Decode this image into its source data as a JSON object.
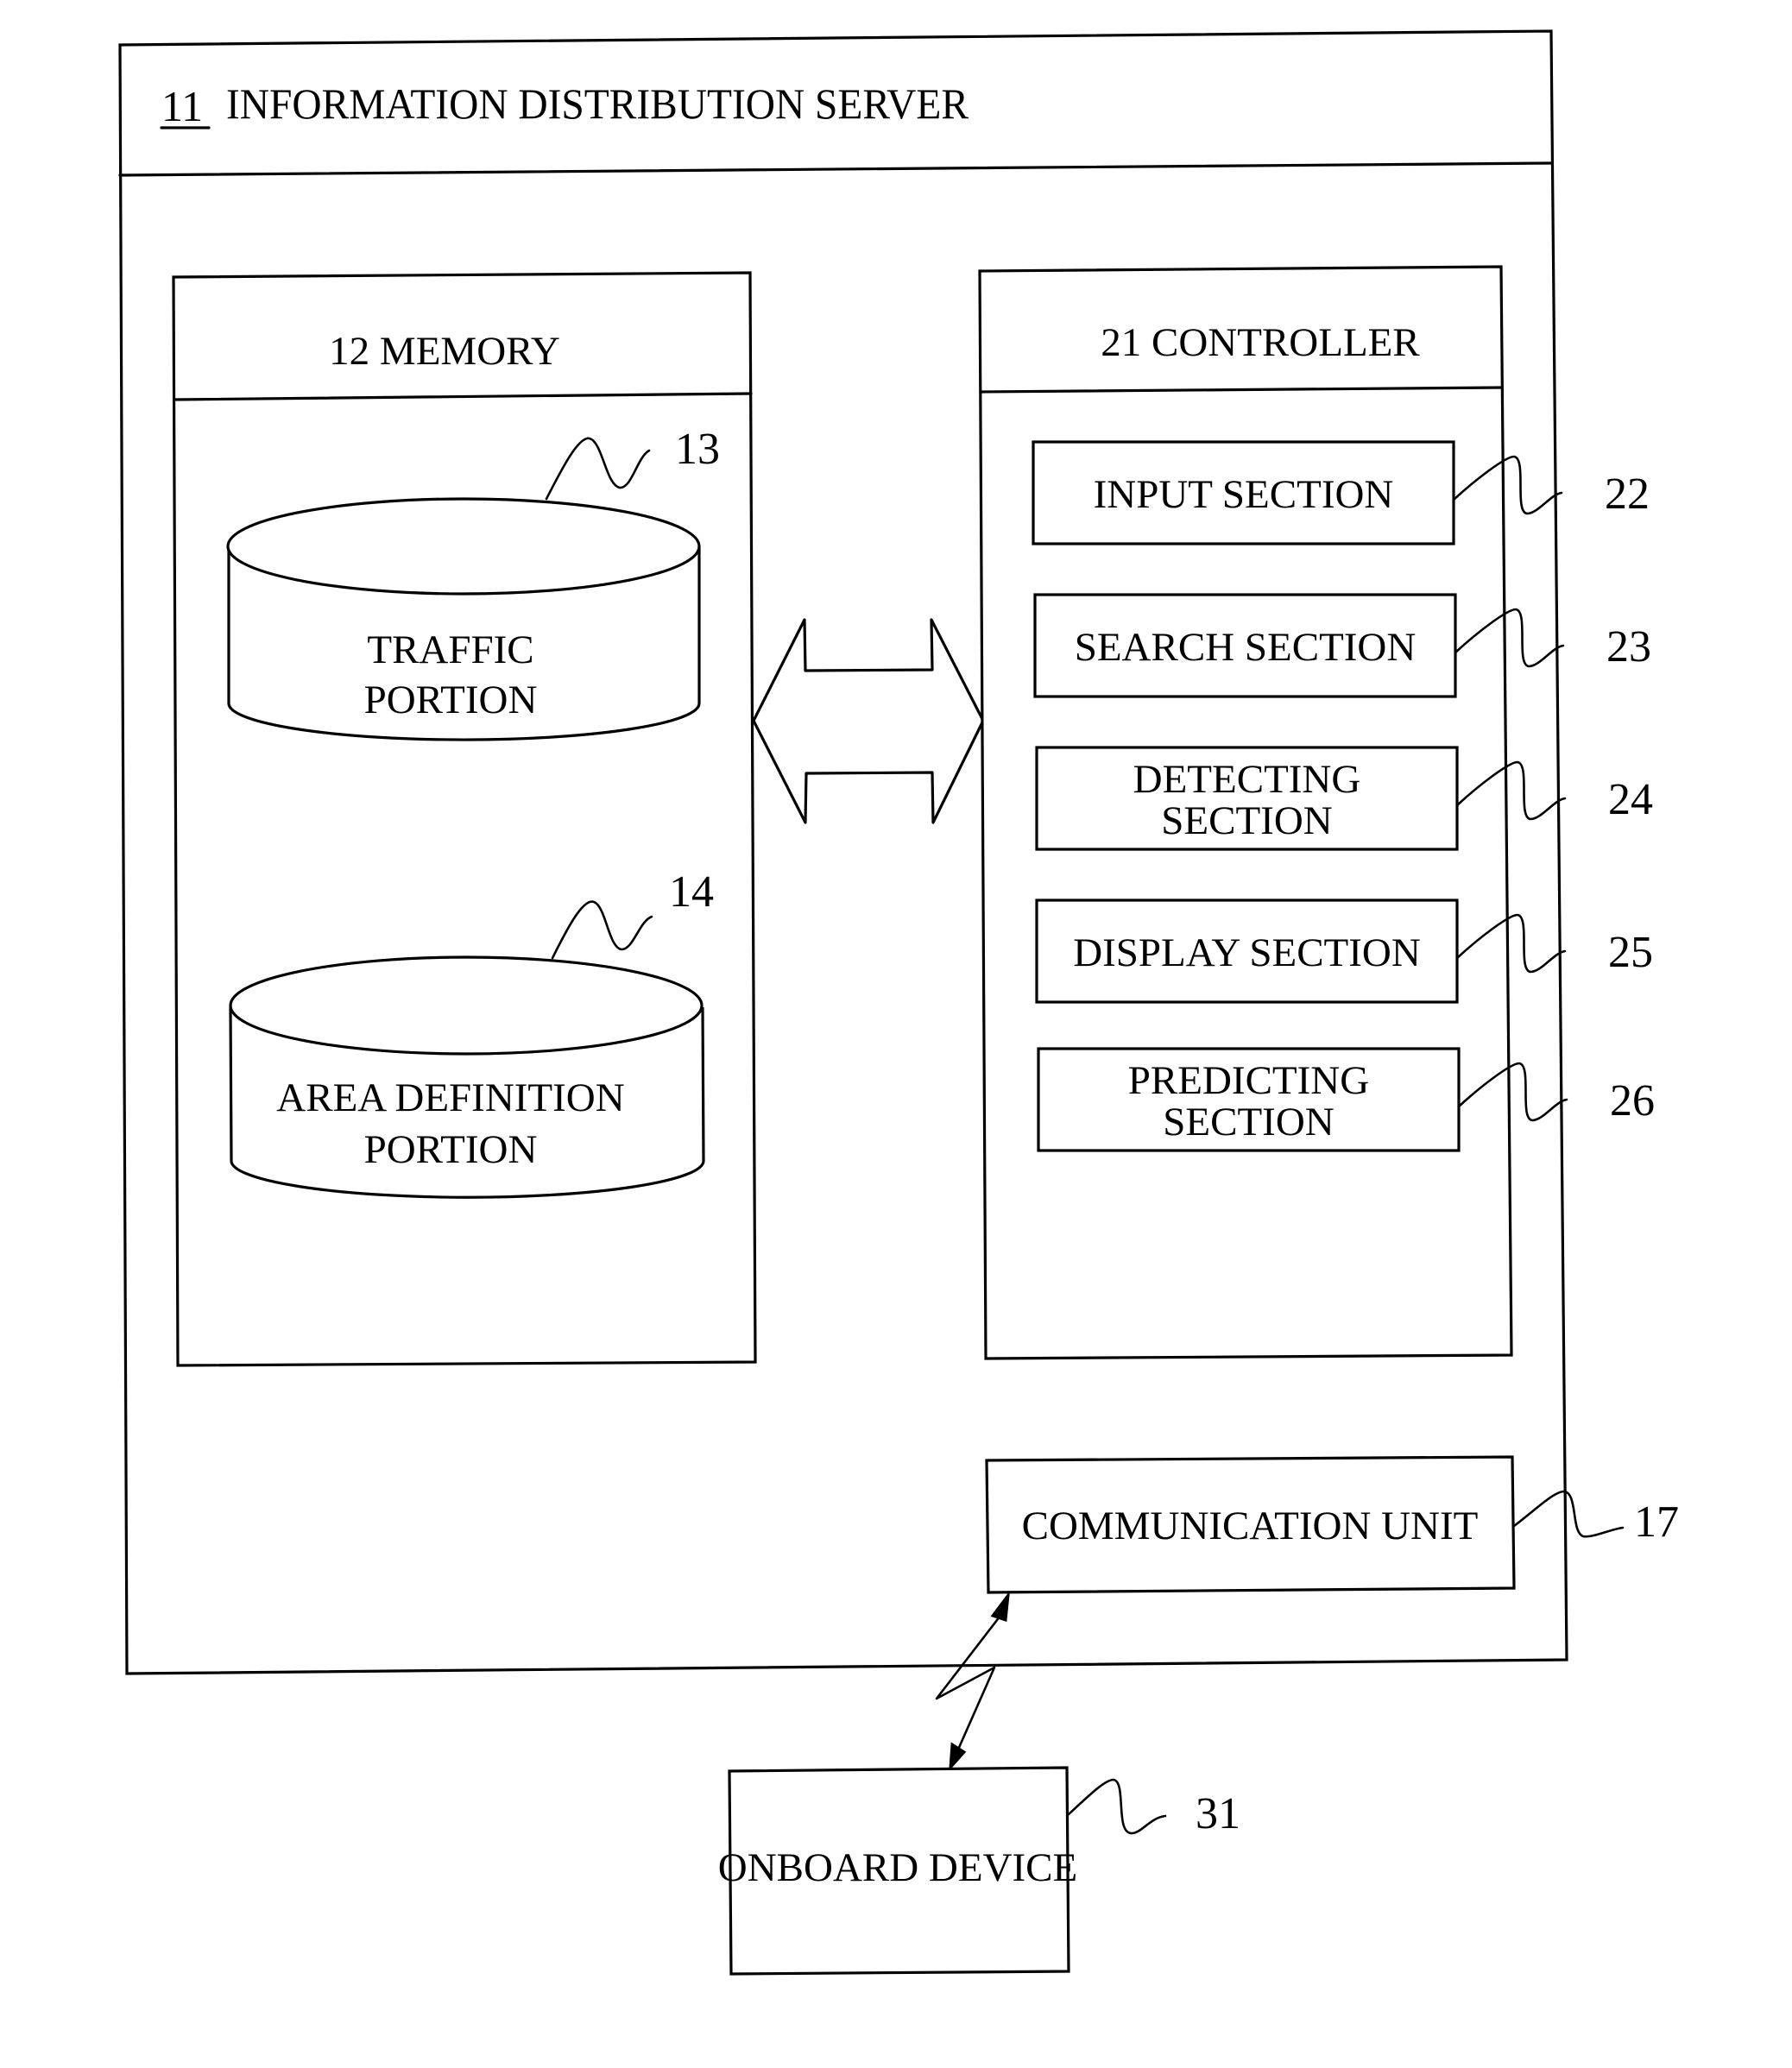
{
  "diagram": {
    "server": {
      "ref": "11",
      "label": "INFORMATION DISTRIBUTION SERVER"
    },
    "memory": {
      "header": "12 MEMORY",
      "traffic": {
        "ref": "13",
        "line1": "TRAFFIC",
        "line2": "PORTION"
      },
      "area": {
        "ref": "14",
        "line1": "AREA DEFINITION",
        "line2": "PORTION"
      }
    },
    "controller": {
      "header": "21 CONTROLLER",
      "sections": [
        {
          "ref": "22",
          "line1": "INPUT SECTION",
          "line2": ""
        },
        {
          "ref": "23",
          "line1": "SEARCH SECTION",
          "line2": ""
        },
        {
          "ref": "24",
          "line1": "DETECTING",
          "line2": "SECTION"
        },
        {
          "ref": "25",
          "line1": "DISPLAY SECTION",
          "line2": ""
        },
        {
          "ref": "26",
          "line1": "PREDICTING",
          "line2": "SECTION"
        }
      ]
    },
    "communication_unit": {
      "ref": "17",
      "label": "COMMUNICATION UNIT"
    },
    "onboard_device": {
      "ref": "31",
      "label": "ONBOARD DEVICE"
    },
    "connections": [
      {
        "from": "memory",
        "to": "controller",
        "type": "bidirectional-block-arrow"
      },
      {
        "from": "communication_unit",
        "to": "onboard_device",
        "type": "wireless-bidirectional"
      }
    ]
  }
}
